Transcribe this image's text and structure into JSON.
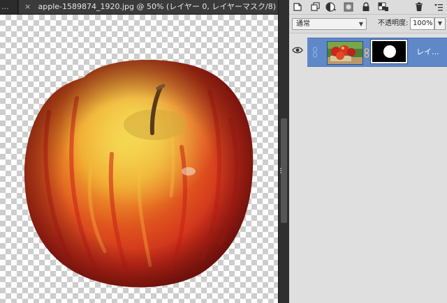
{
  "tabs": [
    {
      "label": "...",
      "active": false
    },
    {
      "close": "×",
      "label": "apple-1589874_1920.jpg @ 50% (レイヤー 0, レイヤーマスク/8) *",
      "active": true
    }
  ],
  "toolbar": {
    "icons": [
      "new-layer-icon",
      "duplicate-layer-icon",
      "adjustment-layer-icon",
      "layer-mask-icon",
      "lock-icon",
      "lock-transparency-icon",
      "trash-icon",
      "panel-menu-icon"
    ]
  },
  "blend": {
    "selected": "通常"
  },
  "opacity": {
    "label": "不透明度:",
    "value": "100%"
  },
  "layers": [
    {
      "name": "レイ...",
      "visible": true,
      "selected": true
    }
  ],
  "colors": {
    "selection": "#5f88c9",
    "panel": "#d8d8d8",
    "tabbar": "#262626"
  }
}
